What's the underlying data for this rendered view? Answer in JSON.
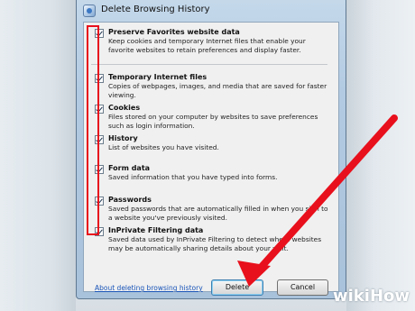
{
  "window": {
    "title": "Delete Browsing History"
  },
  "options": [
    {
      "title": "Preserve Favorites website data",
      "desc": "Keep cookies and temporary Internet files that enable your favorite websites to retain preferences and display faster.",
      "checked": true
    },
    {
      "title": "Temporary Internet files",
      "desc": "Copies of webpages, images, and media that are saved for faster viewing.",
      "checked": true
    },
    {
      "title": "Cookies",
      "desc": "Files stored on your computer by websites to save preferences such as login information.",
      "checked": true
    },
    {
      "title": "History",
      "desc": "List of websites you have visited.",
      "checked": true
    },
    {
      "title": "Form data",
      "desc": "Saved information that you have typed into forms.",
      "checked": true
    },
    {
      "title": "Passwords",
      "desc": "Saved passwords that are automatically filled in when you sign to a website you've previously visited.",
      "checked": true
    },
    {
      "title": "InPrivate Filtering data",
      "desc": "Saved data used by InPrivate Filtering to detect where websites may be automatically sharing details about your visit.",
      "checked": true
    }
  ],
  "footer": {
    "link": "About deleting browsing history",
    "delete_label": "Delete",
    "cancel_label": "Cancel"
  },
  "annotation": {
    "color": "#e8101c"
  },
  "watermark": {
    "wiki": "wiki",
    "how": "How"
  }
}
